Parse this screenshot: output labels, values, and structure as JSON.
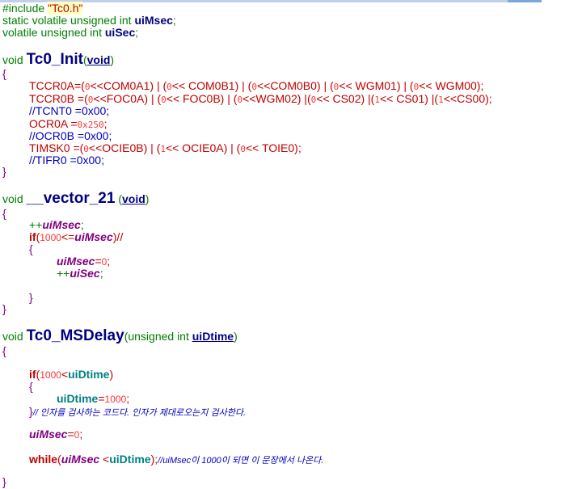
{
  "editor": {
    "lines": {
      "l01": {
        "a": "#include ",
        "b": "\"Tc0.h\""
      },
      "l02": {
        "a": "static volatile unsigned int ",
        "b": "uiMsec",
        "c": ";"
      },
      "l03": {
        "a": "volatile unsigned int ",
        "b": "uiSec",
        "c": ";"
      },
      "l04": {
        "a": "void ",
        "b": "Tc0_Init",
        "c": "(",
        "d": "void",
        "e": ")"
      },
      "l05": {
        "a": "{"
      },
      "l06": {
        "a": "TCCR0A=(",
        "b": "0",
        "c": "<<COM0A1) | (",
        "d": "0",
        "e": "<< COM0B1) | (",
        "f": "0",
        "g": "<<COM0B0) | (",
        "h": "0",
        "i": "<< WGM01) | (",
        "j": "0",
        "k": "<< WGM00);"
      },
      "l07": {
        "a": "TCCR0B =(",
        "b": "0",
        "c": "<<FOC0A) | (",
        "d": "0",
        "e": "<< FOC0B) | (",
        "f": "0",
        "g": "<<WGM02) |(",
        "h": "0",
        "i": "<< CS02) |(",
        "j": "1",
        "k": "<< CS01) |(",
        "l": "1",
        "m": "<<CS00);"
      },
      "l08": {
        "a": "//TCNT0 =0x00;"
      },
      "l09": {
        "a": "OCR0A =",
        "b": "0x250",
        "c": ";"
      },
      "l10": {
        "a": "//OCR0B =0x00;"
      },
      "l11": {
        "a": "TIMSK0 =(",
        "b": "0",
        "c": "<<OCIE0B) | (",
        "d": "1",
        "e": "<< OCIE0A) | (",
        "f": "0",
        "g": "<< TOIE0);"
      },
      "l12": {
        "a": "//TIFR0 =0x00;"
      },
      "l13": {
        "a": "}"
      },
      "l14": {
        "a": "void ",
        "b": "__vector_21",
        "c": " (",
        "d": "void",
        "e": ")"
      },
      "l15": {
        "a": "{"
      },
      "l16": {
        "a": "++",
        "b": "uiMsec",
        "c": ";"
      },
      "l17": {
        "a": "if",
        "b": "(",
        "c": "1000",
        "d": "<=",
        "e": "uiMsec",
        "f": ")//"
      },
      "l18": {
        "a": "{"
      },
      "l19": {
        "a": "uiMsec",
        "b": "=",
        "c": "0",
        "d": ";"
      },
      "l20": {
        "a": "++",
        "b": "uiSec",
        "c": ";"
      },
      "l21": {
        "a": "}"
      },
      "l22": {
        "a": "}"
      },
      "l23": {
        "a": "void ",
        "b": "Tc0_MSDelay",
        "c": "(unsigned int ",
        "d": "uiDtime",
        "e": ")"
      },
      "l24": {
        "a": "{"
      },
      "l25": {
        "a": "if",
        "b": "(",
        "c": "1000",
        "d": "<",
        "e": "uiDtime",
        "f": ")"
      },
      "l26": {
        "a": "{"
      },
      "l27": {
        "a": "uiDtime",
        "b": "=",
        "c": "1000",
        "d": ";"
      },
      "l28": {
        "a": "}",
        "b": "// 인자를 검사하는 코드다. 인자가 제대로오는지 검사한다."
      },
      "l29": {
        "a": "uiMsec",
        "b": "=",
        "c": "0",
        "d": ";"
      },
      "l30": {
        "a": "while",
        "b": "(",
        "c": "uiMsec",
        "d": " <",
        "e": "uiDtime",
        "f": ");",
        "g": "//uiMsec이 1000이 되면 이 문장에서 나온다."
      },
      "l31": {
        "a": "}"
      }
    }
  },
  "colors": {
    "keyword": "#007f00",
    "operator": "#c00000",
    "function": "#000080",
    "variable": "#800080",
    "comment": "#0000c0",
    "number": "#ff3333",
    "highlight": "#ffffc0"
  }
}
